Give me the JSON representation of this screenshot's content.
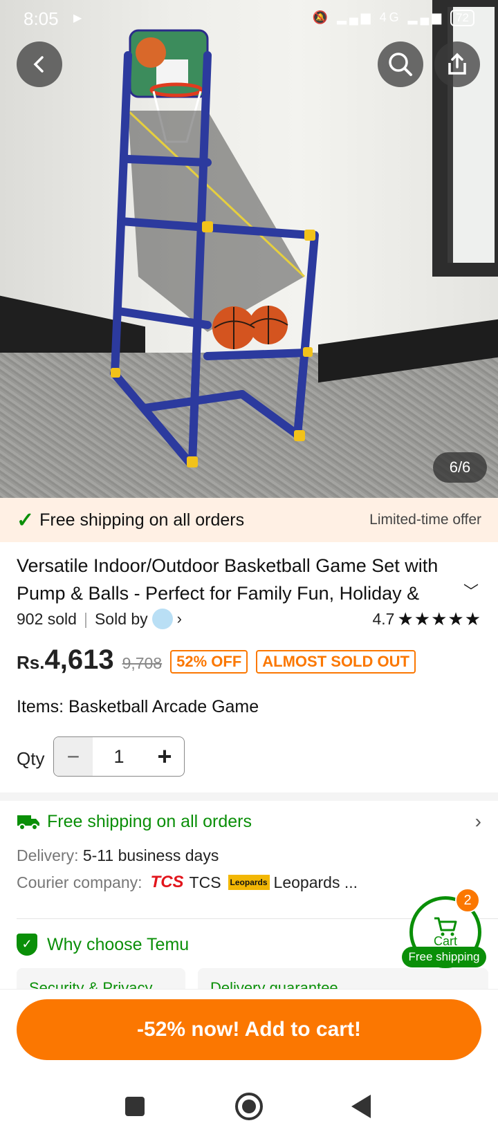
{
  "status_bar": {
    "time": "8:05",
    "battery": "72",
    "network": "4G"
  },
  "gallery": {
    "counter": "6/6"
  },
  "promo_banner": {
    "text": "Free shipping on all orders",
    "offer": "Limited-time offer"
  },
  "product": {
    "title": "Versatile Indoor/Outdoor Basketball Game Set with Pump & Balls - Perfect for Family Fun, Holiday &",
    "sold": "902 sold",
    "sold_by_label": "Sold by",
    "rating": "4.7",
    "stars": "★★★★★",
    "price_prefix": "Rs.",
    "price": "4,613",
    "old_price": "9,708",
    "discount_tag": "52% OFF",
    "stock_tag": "ALMOST SOLD OUT",
    "items_label": "Items: Basketball Arcade Game",
    "qty_label": "Qty",
    "qty_value": "1"
  },
  "shipping": {
    "title": "Free shipping on all orders",
    "delivery_label": "Delivery:",
    "delivery_value": "5-11 business days",
    "courier_label": "Courier company:",
    "courier_1_logo": "TCS",
    "courier_1": "TCS",
    "courier_2_logo": "Leopards",
    "courier_2": "Leopards ..."
  },
  "why_choose": {
    "title": "Why choose Temu",
    "cards": [
      "Security & Privacy",
      "Delivery guarantee"
    ]
  },
  "cart": {
    "label": "Cart",
    "count": "2",
    "free_shipping": "Free shipping"
  },
  "cta": {
    "label": "-52% now! Add to cart!"
  },
  "colors": {
    "accent": "#fb7701",
    "green": "#0a8f08"
  }
}
